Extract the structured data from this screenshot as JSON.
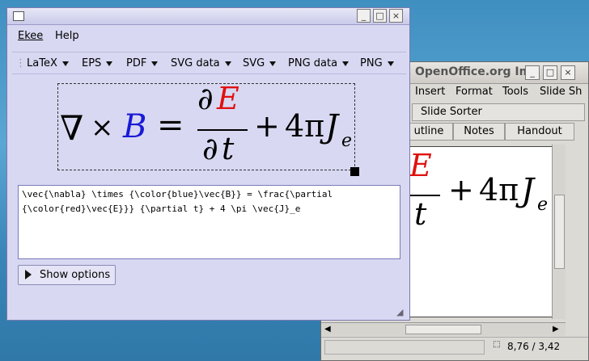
{
  "ekee": {
    "title_icon": "window-icon",
    "menu": [
      "Ekee",
      "Help"
    ],
    "toolbar": [
      "LaTeX",
      "EPS",
      "PDF",
      "SVG data",
      "SVG",
      "PNG data",
      "PNG"
    ],
    "code_lines": [
      "\\vec{\\nabla} \\times {\\color{blue}\\vec{B}} = \\frac{\\partial",
      "{\\color{red}\\vec{E}}} {\\partial t} + 4 \\pi \\vec{J}_e"
    ],
    "show_options": "Show options",
    "formula": {
      "nabla": "∇",
      "times": "×",
      "B": "B",
      "eq": "=",
      "partial": "∂",
      "E": "E",
      "t": "t",
      "plus": "+",
      "four_pi": "4π",
      "J": "J",
      "sub_e": "e",
      "arrow": "→"
    }
  },
  "openoffice": {
    "title": "OpenOffice.org Im",
    "menu": [
      "Insert",
      "Format",
      "Tools",
      "Slide Sh"
    ],
    "slide_sorter": "Slide Sorter",
    "tabs": [
      "utline",
      "Notes",
      "Handout"
    ],
    "status": "8,76 / 3,42"
  },
  "colors": {
    "blue": "#1a1ad6",
    "red": "#e01010",
    "ekee_bg": "#d8d8f2",
    "oo_bg": "#dcdad5"
  }
}
